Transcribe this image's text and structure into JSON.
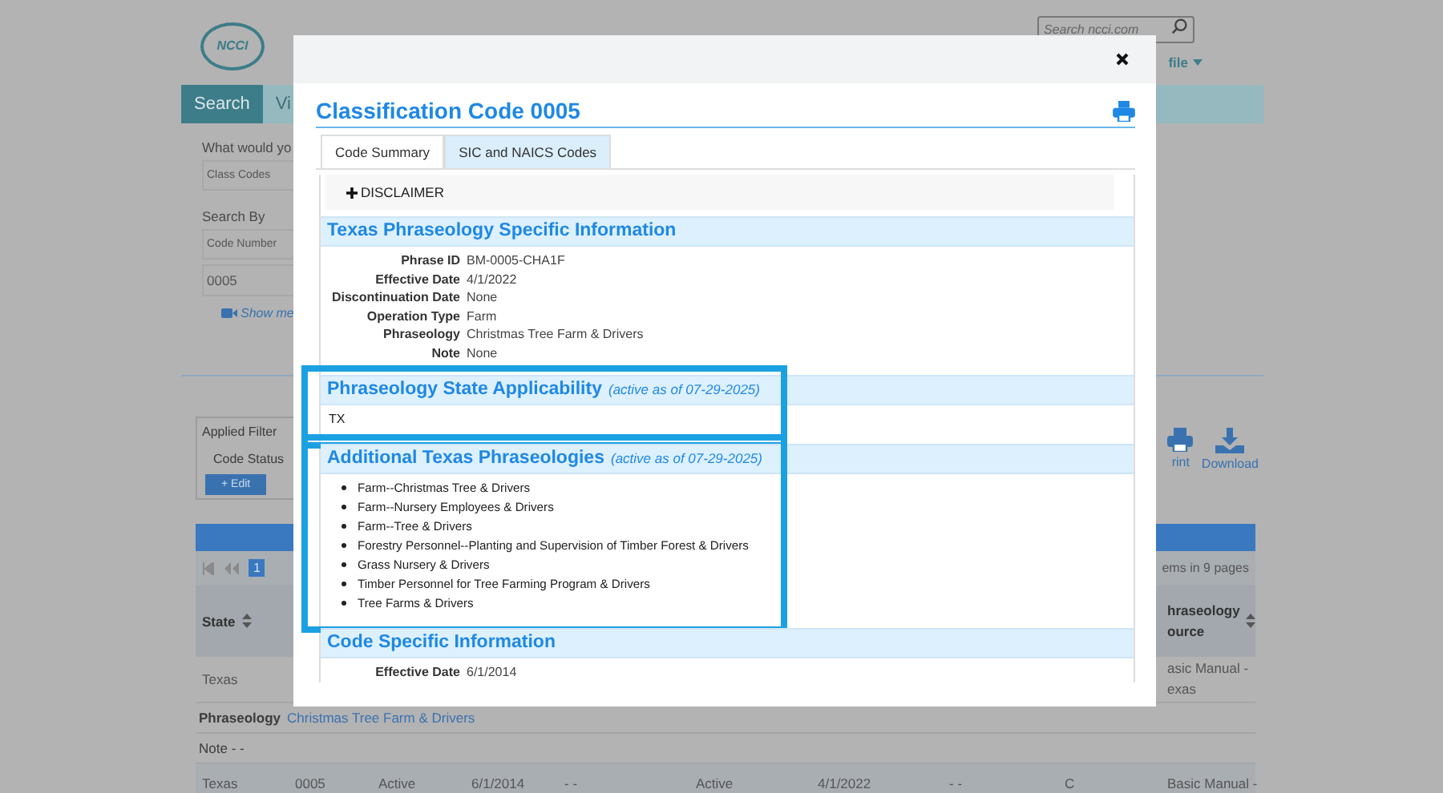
{
  "background": {
    "logo": "NCCI",
    "search": {
      "placeholder": "Search ncci.com"
    },
    "profile_menu": "file",
    "nav_tabs": [
      {
        "label": "Search",
        "selected": true
      },
      {
        "label": "Vi",
        "selected": false
      }
    ],
    "form": {
      "question": "What would yo",
      "type_select": "Class Codes",
      "search_by_label": "Search By",
      "search_by_select": "Code Number",
      "code_input": "0005",
      "video_link": "Show me"
    },
    "filters": {
      "title": "Applied Filter",
      "code_status": "Code Status",
      "edit_button": "+ Edit"
    },
    "actions": [
      {
        "kind": "print",
        "label": "rint"
      },
      {
        "kind": "download",
        "label": "Download"
      }
    ],
    "pager": {
      "pages": [
        {
          "label": "1",
          "selected": true
        }
      ],
      "summary": "ems in 9 pages"
    },
    "table": {
      "state_heading": "State",
      "source_heading": "hraseology ource",
      "first_row": {
        "state": "Texas",
        "source": "asic Manual - exas",
        "phraseology_label": "Phraseology",
        "phraseology": "Christmas Tree Farm & Drivers",
        "note": "Note - -"
      },
      "second_row": [
        "Texas",
        "0005",
        "Active",
        "6/1/2014",
        "- -",
        "Active",
        "4/1/2022",
        "- -",
        "C",
        "Basic Manual -"
      ]
    }
  },
  "modal": {
    "title": "Classification Code 0005",
    "tabs": [
      {
        "label": "Code Summary",
        "selected": true
      },
      {
        "label": "SIC and NAICS Codes",
        "selected": false
      }
    ],
    "disclaimer": "DISCLAIMER",
    "sections": [
      {
        "kind": "details",
        "title": "Texas Phraseology Specific Information",
        "highlighted": false,
        "fields": [
          {
            "label": "Phrase ID",
            "value": "BM-0005-CHA1F"
          },
          {
            "label": "Effective Date",
            "value": "4/1/2022"
          },
          {
            "label": "Discontinuation Date",
            "value": "None"
          },
          {
            "label": "Operation Type",
            "value": "Farm"
          },
          {
            "label": "Phraseology",
            "value": "Christmas Tree Farm & Drivers"
          },
          {
            "label": "Note",
            "value": "None"
          }
        ]
      },
      {
        "kind": "text",
        "title": "Phraseology State Applicability",
        "note": "(active as of 07-29-2025)",
        "highlighted": true,
        "text": "TX"
      },
      {
        "kind": "list",
        "title": "Additional Texas Phraseologies",
        "note": "(active as of 07-29-2025)",
        "highlighted": true,
        "items": [
          "Farm--Christmas Tree & Drivers",
          "Farm--Nursery Employees & Drivers",
          "Farm--Tree & Drivers",
          "Forestry Personnel--Planting and Supervision of Timber Forest & Drivers",
          "Grass Nursery & Drivers",
          "Timber Personnel for Tree Farming Program & Drivers",
          "Tree Farms & Drivers"
        ]
      },
      {
        "kind": "details",
        "title": "Code Specific Information",
        "highlighted": false,
        "fields": [
          {
            "label": "Effective Date",
            "value": "6/1/2014"
          }
        ]
      }
    ]
  }
}
